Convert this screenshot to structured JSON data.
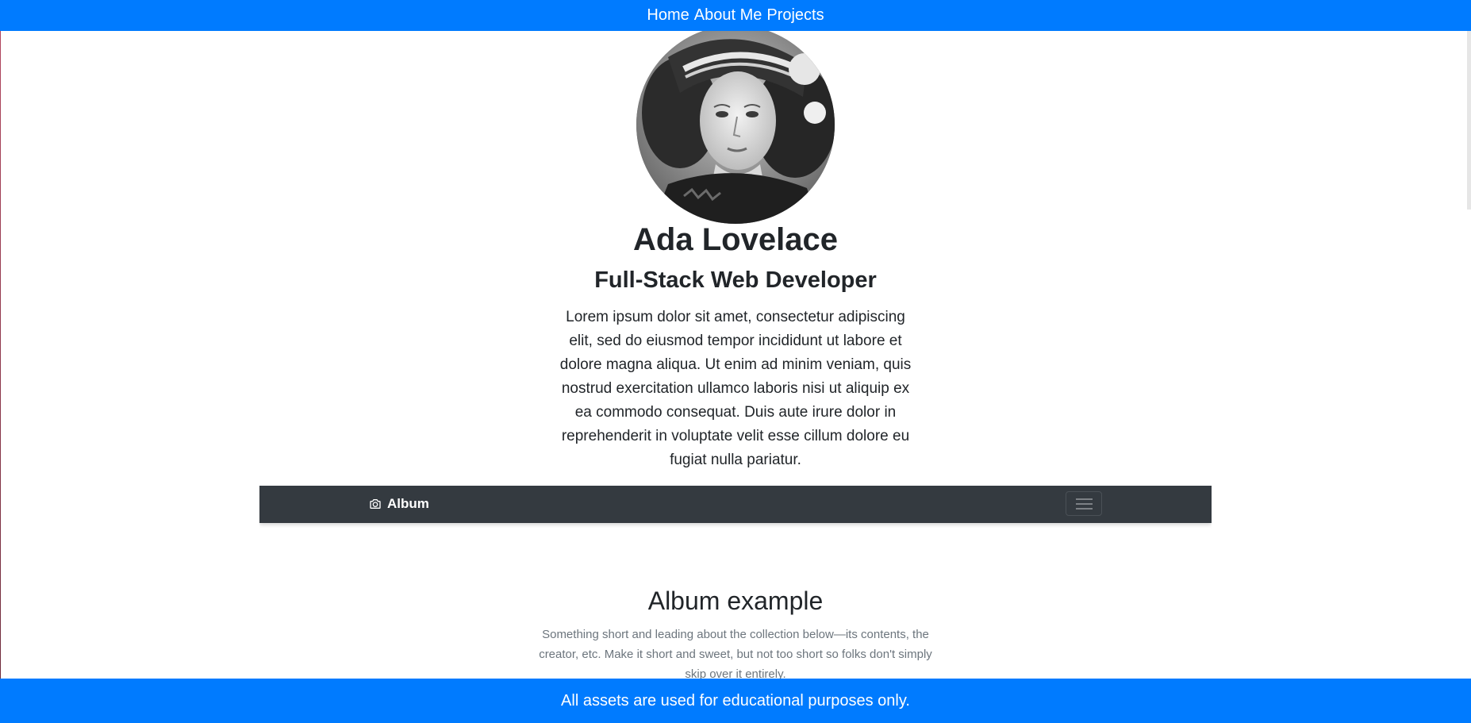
{
  "nav": {
    "items": [
      {
        "label": "Home"
      },
      {
        "label": "About Me"
      },
      {
        "label": "Projects"
      }
    ]
  },
  "profile": {
    "name": "Ada Lovelace",
    "role": "Full-Stack Web Developer",
    "bio": "Lorem ipsum dolor sit amet, consectetur adipiscing elit, sed do eiusmod tempor incididunt ut labore et dolore magna aliqua. Ut enim ad minim veniam, quis nostrud exercitation ullamco laboris nisi ut aliquip ex ea commodo consequat. Duis aute irure dolor in reprehenderit in voluptate velit esse cillum dolore eu fugiat nulla pariatur.",
    "avatar_icon": "portrait-photo"
  },
  "album_preview": {
    "brand": "Album",
    "brand_icon": "camera-icon",
    "menu_icon": "hamburger-icon",
    "title": "Album example",
    "lead": "Something short and leading about the collection below—its contents, the creator, etc. Make it short and sweet, but not too short so folks don't simply skip over it entirely."
  },
  "footer": {
    "text": "All assets are used for educational purposes only."
  },
  "colors": {
    "primary": "#007bff",
    "album_bar": "#343a40",
    "text": "#212529",
    "muted": "#6c757d"
  }
}
